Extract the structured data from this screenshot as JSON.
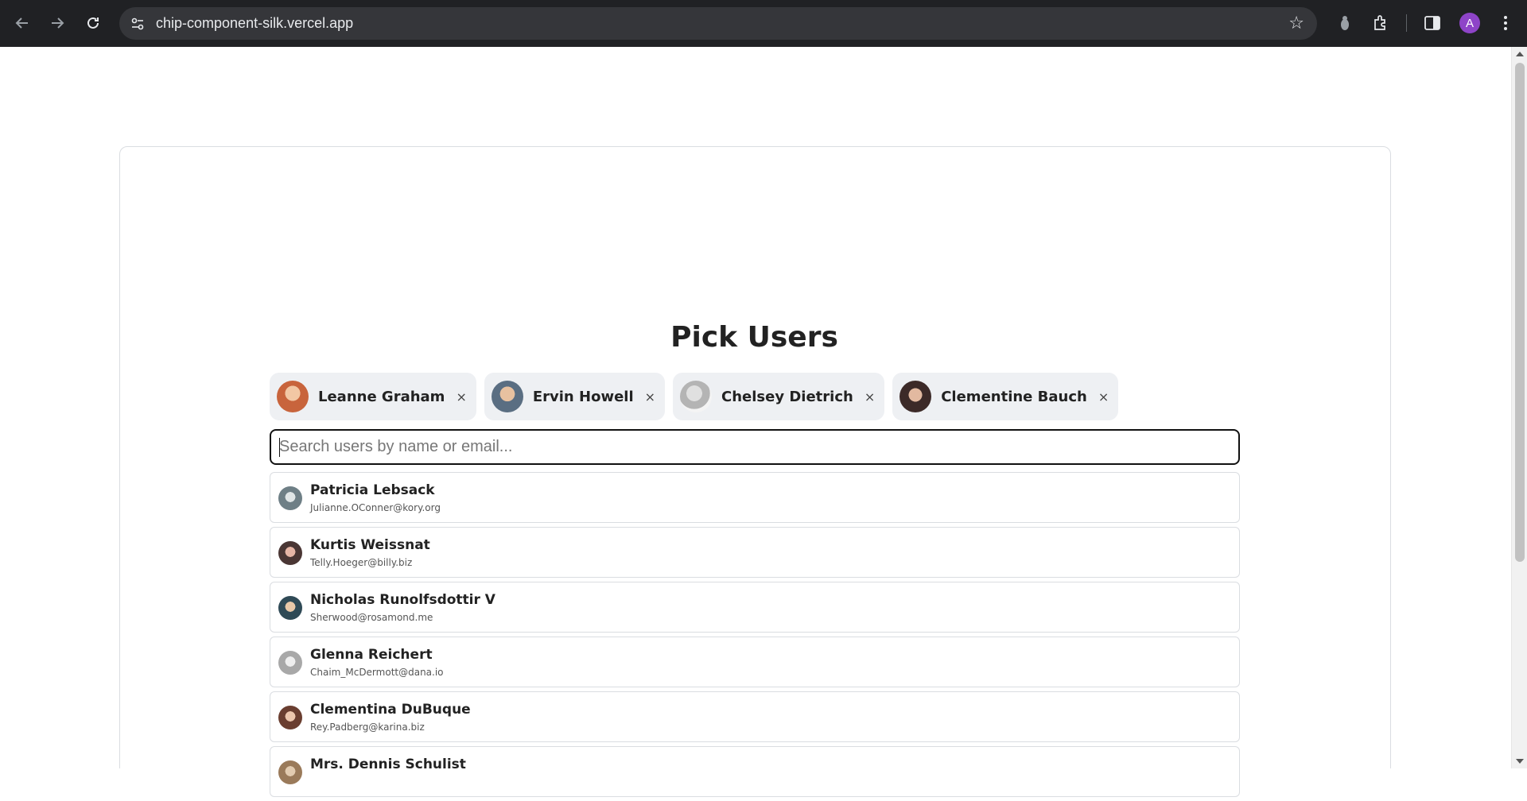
{
  "browser": {
    "url": "chip-component-silk.vercel.app",
    "profile_initial": "A",
    "profile_color": "#8e44c8"
  },
  "page": {
    "title": "Pick Users",
    "search_placeholder": "Search users by name or email...",
    "chip_close_glyph": "×"
  },
  "selected_users": [
    {
      "name": "Leanne Graham",
      "avatar_color": "#c8643c"
    },
    {
      "name": "Ervin Howell",
      "avatar_color": "#5a6e82"
    },
    {
      "name": "Chelsey Dietrich",
      "avatar_color": "#b4b4b4"
    },
    {
      "name": "Clementine Bauch",
      "avatar_color": "#3c2a28"
    }
  ],
  "suggestions": [
    {
      "name": "Patricia Lebsack",
      "email": "Julianne.OConner@kory.org",
      "avatar_color": "#6e7f86"
    },
    {
      "name": "Kurtis Weissnat",
      "email": "Telly.Hoeger@billy.biz",
      "avatar_color": "#4a3634"
    },
    {
      "name": "Nicholas Runolfsdottir V",
      "email": "Sherwood@rosamond.me",
      "avatar_color": "#2f4a56"
    },
    {
      "name": "Glenna Reichert",
      "email": "Chaim_McDermott@dana.io",
      "avatar_color": "#a8a8a8"
    },
    {
      "name": "Clementina DuBuque",
      "email": "Rey.Padberg@karina.biz",
      "avatar_color": "#6a3e30"
    },
    {
      "name": "Mrs. Dennis Schulist",
      "email": "",
      "avatar_color": "#9a7a5a"
    }
  ]
}
